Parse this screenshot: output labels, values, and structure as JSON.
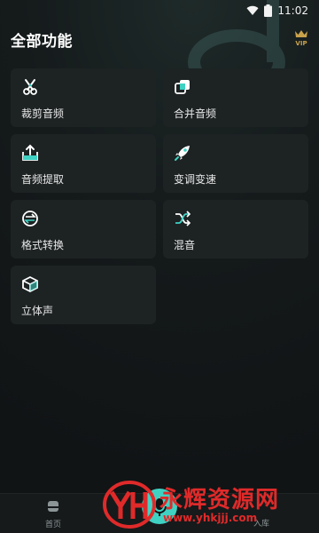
{
  "status_bar": {
    "time": "11:02"
  },
  "header": {
    "title": "全部功能",
    "vip_badge": "VIP"
  },
  "features": [
    {
      "label": "裁剪音频",
      "icon": "scissors-icon"
    },
    {
      "label": "合并音频",
      "icon": "merge-icon"
    },
    {
      "label": "音频提取",
      "icon": "upload-extract-icon"
    },
    {
      "label": "变调变速",
      "icon": "rocket-icon"
    },
    {
      "label": "格式转换",
      "icon": "convert-icon"
    },
    {
      "label": "混音",
      "icon": "shuffle-mix-icon"
    },
    {
      "label": "立体声",
      "icon": "cube-icon"
    }
  ],
  "bottom_nav": {
    "home_label": "首页",
    "right_label": "入库"
  },
  "watermark": {
    "brand": "永辉资源网",
    "url": "www.yhkjjj.com"
  },
  "colors": {
    "accent": "#3fd2c3",
    "card_bg": "#1d2223",
    "background": "#121517"
  }
}
